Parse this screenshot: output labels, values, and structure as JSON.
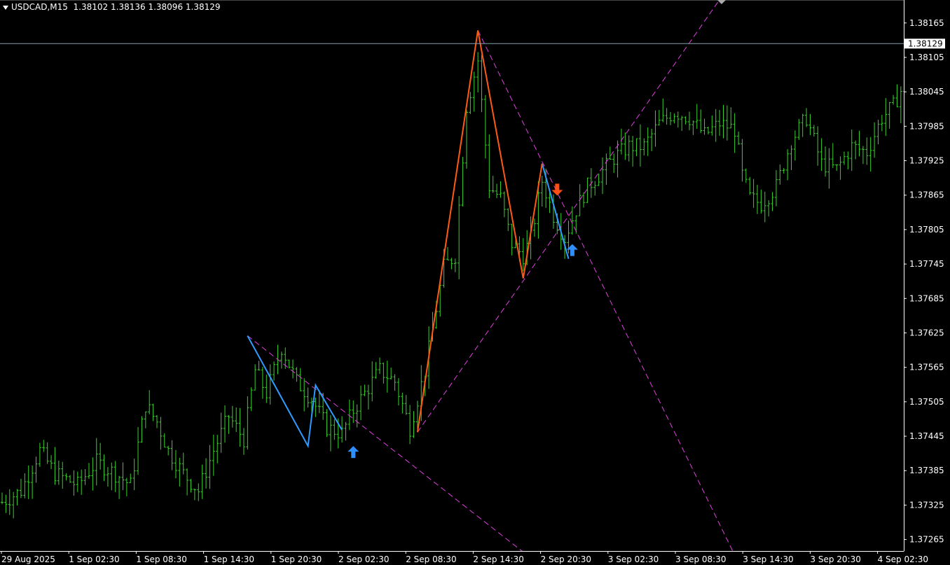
{
  "header": {
    "symbol": "USDCAD,M15",
    "open": "1.38102",
    "high": "1.38136",
    "low": "1.38096",
    "close": "1.38129"
  },
  "colors": {
    "background": "#000000",
    "candles": "#39d12b",
    "axis": "#ffffff",
    "zigzag_orange": "#ff5a14",
    "zigzag_blue": "#2f9bff",
    "trendline": "#e040e0",
    "price_line": "#7f9fb0",
    "arrow_up": "#2f8fff",
    "arrow_down": "#ff4e12"
  },
  "chart_data": {
    "type": "candlestick",
    "current_price": 1.38129,
    "current_price_label": "1.38129",
    "ylim": [
      1.37245,
      1.38205
    ],
    "y_ticks": [
      "1.38165",
      "1.38105",
      "1.38045",
      "1.37985",
      "1.37925",
      "1.37865",
      "1.37805",
      "1.37745",
      "1.37685",
      "1.37625",
      "1.37565",
      "1.37505",
      "1.37445",
      "1.37385",
      "1.37325",
      "1.37265"
    ],
    "x_ticks": [
      "29 Aug 2025",
      "1 Sep 02:30",
      "1 Sep 08:30",
      "1 Sep 14:30",
      "1 Sep 20:30",
      "2 Sep 02:30",
      "2 Sep 08:30",
      "2 Sep 14:30",
      "2 Sep 20:30",
      "3 Sep 02:30",
      "3 Sep 08:30",
      "3 Sep 14:30",
      "3 Sep 20:30",
      "4 Sep 02:30"
    ],
    "bar_count": 240,
    "close_path": [
      [
        0,
        1.3733
      ],
      [
        5,
        1.3735
      ],
      [
        10,
        1.3742
      ],
      [
        14,
        1.3738
      ],
      [
        20,
        1.3736
      ],
      [
        25,
        1.374
      ],
      [
        30,
        1.3738
      ],
      [
        34,
        1.3736
      ],
      [
        38,
        1.375
      ],
      [
        41,
        1.3747
      ],
      [
        44,
        1.3742
      ],
      [
        48,
        1.3738
      ],
      [
        52,
        1.3735
      ],
      [
        56,
        1.3742
      ],
      [
        60,
        1.3748
      ],
      [
        64,
        1.3744
      ],
      [
        67,
        1.3756
      ],
      [
        70,
        1.3752
      ],
      [
        74,
        1.376
      ],
      [
        78,
        1.3754
      ],
      [
        82,
        1.3751
      ],
      [
        86,
        1.3746
      ],
      [
        90,
        1.3745
      ],
      [
        93,
        1.3749
      ],
      [
        96,
        1.3752
      ],
      [
        100,
        1.3756
      ],
      [
        104,
        1.3754
      ],
      [
        108,
        1.3746
      ],
      [
        112,
        1.3756
      ],
      [
        117,
        1.3774
      ],
      [
        120,
        1.3776
      ],
      [
        123,
        1.3802
      ],
      [
        126,
        1.381
      ],
      [
        129,
        1.3788
      ],
      [
        132,
        1.3786
      ],
      [
        135,
        1.3778
      ],
      [
        138,
        1.3776
      ],
      [
        140,
        1.3779
      ],
      [
        143,
        1.3789
      ],
      [
        146,
        1.3783
      ],
      [
        149,
        1.3779
      ],
      [
        152,
        1.3784
      ],
      [
        155,
        1.3788
      ],
      [
        158,
        1.379
      ],
      [
        162,
        1.3793
      ],
      [
        166,
        1.3795
      ],
      [
        170,
        1.3795
      ],
      [
        174,
        1.3799
      ],
      [
        178,
        1.3801
      ],
      [
        182,
        1.38
      ],
      [
        186,
        1.3797
      ],
      [
        190,
        1.3799
      ],
      [
        194,
        1.3798
      ],
      [
        196,
        1.379
      ],
      [
        198,
        1.3786
      ],
      [
        201,
        1.3785
      ],
      [
        205,
        1.3788
      ],
      [
        209,
        1.3796
      ],
      [
        213,
        1.38
      ],
      [
        217,
        1.3792
      ],
      [
        221,
        1.3791
      ],
      [
        225,
        1.3795
      ],
      [
        229,
        1.3794
      ],
      [
        233,
        1.38
      ],
      [
        236,
        1.3802
      ],
      [
        239,
        1.3806
      ]
    ],
    "zigzag_orange": [
      [
        110,
        1.37452
      ],
      [
        126,
        1.38152
      ],
      [
        138,
        1.3772
      ],
      [
        143,
        1.3792
      ]
    ],
    "zigzag_blue": [
      [
        65,
        1.3762
      ],
      [
        81,
        1.37428
      ],
      [
        83,
        1.37534
      ],
      [
        90,
        1.37456
      ],
      [
        143,
        1.3792
      ],
      [
        150,
        1.37754
      ]
    ],
    "trendlines": [
      {
        "from": [
          65,
          1.3762
        ],
        "to": [
          145,
          1.37207
        ]
      },
      {
        "from": [
          126,
          1.38152
        ],
        "to": [
          196,
          1.37211
        ]
      },
      {
        "from": [
          110,
          1.37452
        ],
        "to": [
          191,
          1.38215
        ]
      }
    ],
    "arrows": [
      {
        "dir": "up",
        "x": 93,
        "y": 1.37418
      },
      {
        "dir": "down",
        "x": 147,
        "y": 1.37874
      },
      {
        "dir": "up",
        "x": 151,
        "y": 1.3777
      }
    ]
  }
}
